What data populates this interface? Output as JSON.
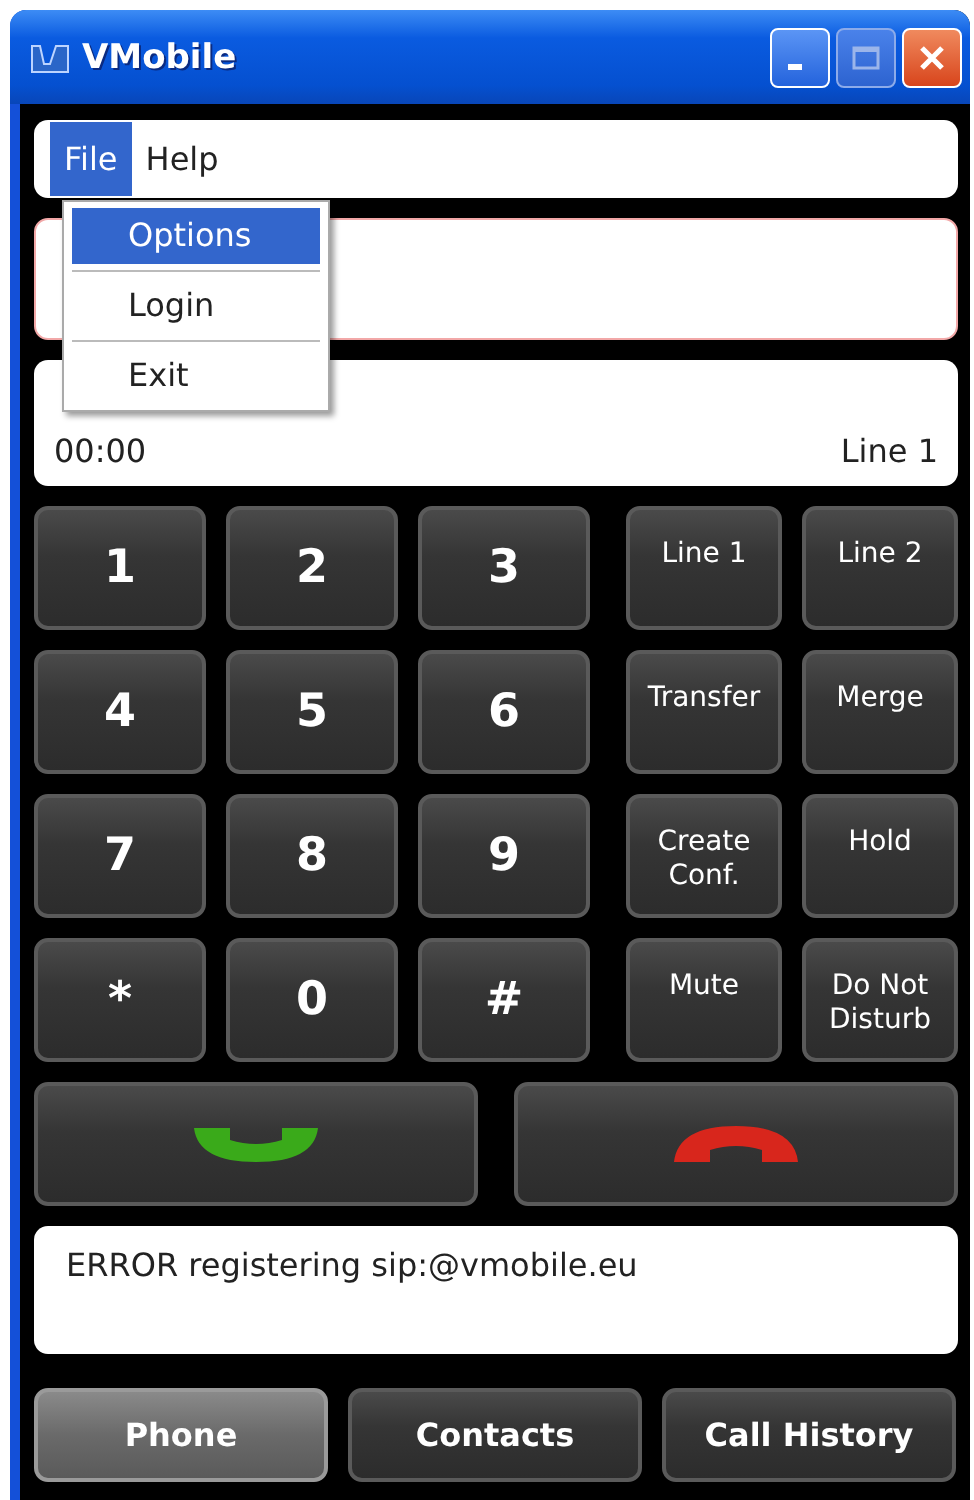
{
  "window": {
    "title": "VMobile"
  },
  "menu_bar": [
    {
      "label": "File",
      "selected": true
    },
    {
      "label": "Help",
      "selected": false
    }
  ],
  "menu_dropdown": [
    {
      "label": "Options",
      "selected": true
    },
    {
      "label": "Login",
      "selected": false
    },
    {
      "label": "Exit",
      "selected": false
    }
  ],
  "display": {
    "timer": "00:00",
    "line": "Line 1"
  },
  "keypad": [
    "1",
    "2",
    "3",
    "4",
    "5",
    "6",
    "7",
    "8",
    "9",
    "*",
    "0",
    "#"
  ],
  "function_keys": [
    "Line 1",
    "Line 2",
    "Transfer",
    "Merge",
    "Create Conf.",
    "Hold",
    "Mute",
    "Do Not Disturb"
  ],
  "status_message": "ERROR registering sip:@vmobile.eu",
  "tabs": [
    {
      "label": "Phone",
      "selected": true
    },
    {
      "label": "Contacts",
      "selected": false
    },
    {
      "label": "Call History",
      "selected": false
    }
  ]
}
